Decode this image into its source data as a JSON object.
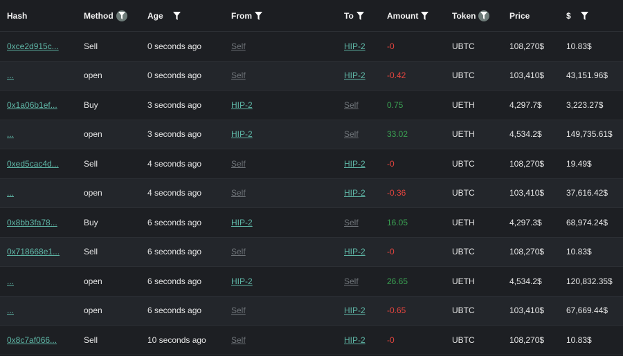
{
  "headers": [
    {
      "label": "Hash",
      "filter": "none"
    },
    {
      "label": "Method",
      "filter": "active"
    },
    {
      "label": "Age",
      "filter": "plain"
    },
    {
      "label": "From",
      "filter": "plain"
    },
    {
      "label": "To",
      "filter": "plain"
    },
    {
      "label": "Amount",
      "filter": "plain"
    },
    {
      "label": "Token",
      "filter": "active"
    },
    {
      "label": "Price",
      "filter": "none"
    },
    {
      "label": "$",
      "filter": "plain"
    }
  ],
  "rows": [
    {
      "hash": "0xce2d915c...",
      "method": "Sell",
      "age": "0 seconds ago",
      "from": "Self",
      "to": "HIP-2",
      "amount": "-0",
      "token": "UBTC",
      "price": "108,270$",
      "usd": "10.83$"
    },
    {
      "hash": "...",
      "method": "open",
      "age": "0 seconds ago",
      "from": "Self",
      "to": "HIP-2",
      "amount": "-0.42",
      "token": "UBTC",
      "price": "103,410$",
      "usd": "43,151.96$"
    },
    {
      "hash": "0x1a06b1ef...",
      "method": "Buy",
      "age": "3 seconds ago",
      "from": "HIP-2",
      "to": "Self",
      "amount": "0.75",
      "token": "UETH",
      "price": "4,297.7$",
      "usd": "3,223.27$"
    },
    {
      "hash": "...",
      "method": "open",
      "age": "3 seconds ago",
      "from": "HIP-2",
      "to": "Self",
      "amount": "33.02",
      "token": "UETH",
      "price": "4,534.2$",
      "usd": "149,735.61$"
    },
    {
      "hash": "0xed5cac4d...",
      "method": "Sell",
      "age": "4 seconds ago",
      "from": "Self",
      "to": "HIP-2",
      "amount": "-0",
      "token": "UBTC",
      "price": "108,270$",
      "usd": "19.49$"
    },
    {
      "hash": "...",
      "method": "open",
      "age": "4 seconds ago",
      "from": "Self",
      "to": "HIP-2",
      "amount": "-0.36",
      "token": "UBTC",
      "price": "103,410$",
      "usd": "37,616.42$"
    },
    {
      "hash": "0x8bb3fa78...",
      "method": "Buy",
      "age": "6 seconds ago",
      "from": "HIP-2",
      "to": "Self",
      "amount": "16.05",
      "token": "UETH",
      "price": "4,297.3$",
      "usd": "68,974.24$"
    },
    {
      "hash": "0x718668e1...",
      "method": "Sell",
      "age": "6 seconds ago",
      "from": "Self",
      "to": "HIP-2",
      "amount": "-0",
      "token": "UBTC",
      "price": "108,270$",
      "usd": "10.83$"
    },
    {
      "hash": "...",
      "method": "open",
      "age": "6 seconds ago",
      "from": "HIP-2",
      "to": "Self",
      "amount": "26.65",
      "token": "UETH",
      "price": "4,534.2$",
      "usd": "120,832.35$"
    },
    {
      "hash": "...",
      "method": "open",
      "age": "6 seconds ago",
      "from": "Self",
      "to": "HIP-2",
      "amount": "-0.65",
      "token": "UBTC",
      "price": "103,410$",
      "usd": "67,669.44$"
    },
    {
      "hash": "0x8c7af066...",
      "method": "Sell",
      "age": "10 seconds ago",
      "from": "Self",
      "to": "HIP-2",
      "amount": "-0",
      "token": "UBTC",
      "price": "108,270$",
      "usd": "10.83$"
    }
  ],
  "colors": {
    "link": "#5fb7a7",
    "self": "#6f7479",
    "negative": "#e0443e",
    "positive": "#3aa052"
  },
  "icons": {
    "filter": "filter-icon"
  }
}
